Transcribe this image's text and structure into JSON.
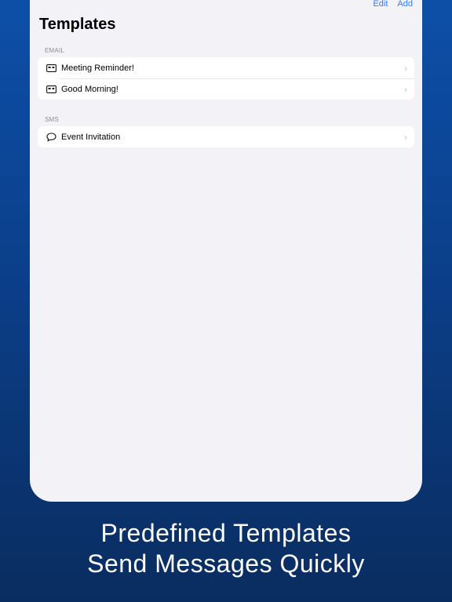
{
  "nav": {
    "edit_label": "Edit",
    "add_label": "Add"
  },
  "page": {
    "title": "Templates"
  },
  "sections": [
    {
      "header": "EMAIL",
      "items": [
        {
          "label": "Meeting Reminder!",
          "icon": "email-card-icon"
        },
        {
          "label": "Good Morning!",
          "icon": "email-card-icon"
        }
      ]
    },
    {
      "header": "SMS",
      "items": [
        {
          "label": "Event Invitation",
          "icon": "chat-bubble-icon"
        }
      ]
    }
  ],
  "tagline": {
    "line1": "Predefined Templates",
    "line2": "Send Messages Quickly"
  },
  "colors": {
    "accent": "#2f7cf6",
    "background_top": "#0d4fa8",
    "background_bottom": "#0a2d60",
    "list_background": "#f2f2f7"
  }
}
